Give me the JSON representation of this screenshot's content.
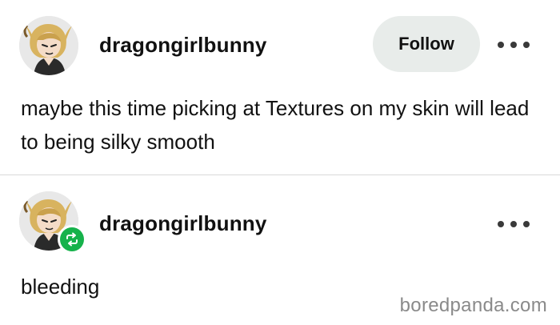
{
  "posts": [
    {
      "username": "dragongirlbunny",
      "follow_label": "Follow",
      "text": "maybe this time picking at Textures on my skin will lead to being silky smooth"
    },
    {
      "username": "dragongirlbunny",
      "text": "bleeding"
    }
  ],
  "watermark": "boredpanda.com",
  "colors": {
    "follow_button_bg": "#e8ecea",
    "reblog_badge": "#16b24b",
    "divider": "#d9d9d9",
    "watermark": "#8a8a8a"
  },
  "icons": {
    "more": "more-icon",
    "reblog": "reblog-icon"
  }
}
